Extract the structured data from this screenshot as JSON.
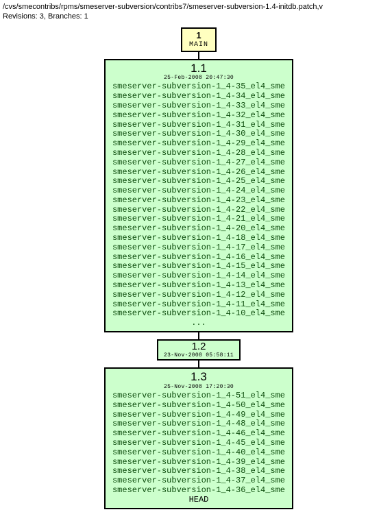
{
  "path": "/cvs/smecontribs/rpms/smeserver-subversion/contribs7/smeserver-subversion-1.4-initdb.patch,v",
  "info": "Revisions: 3, Branches: 1",
  "branch": {
    "number": "1",
    "name": "MAIN"
  },
  "rev11": {
    "title": "1.1",
    "date": "25-Feb-2008 20:47:30",
    "tags": [
      "smeserver-subversion-1_4-35_el4_sme",
      "smeserver-subversion-1_4-34_el4_sme",
      "smeserver-subversion-1_4-33_el4_sme",
      "smeserver-subversion-1_4-32_el4_sme",
      "smeserver-subversion-1_4-31_el4_sme",
      "smeserver-subversion-1_4-30_el4_sme",
      "smeserver-subversion-1_4-29_el4_sme",
      "smeserver-subversion-1_4-28_el4_sme",
      "smeserver-subversion-1_4-27_el4_sme",
      "smeserver-subversion-1_4-26_el4_sme",
      "smeserver-subversion-1_4-25_el4_sme",
      "smeserver-subversion-1_4-24_el4_sme",
      "smeserver-subversion-1_4-23_el4_sme",
      "smeserver-subversion-1_4-22_el4_sme",
      "smeserver-subversion-1_4-21_el4_sme",
      "smeserver-subversion-1_4-20_el4_sme",
      "smeserver-subversion-1_4-18_el4_sme",
      "smeserver-subversion-1_4-17_el4_sme",
      "smeserver-subversion-1_4-16_el4_sme",
      "smeserver-subversion-1_4-15_el4_sme",
      "smeserver-subversion-1_4-14_el4_sme",
      "smeserver-subversion-1_4-13_el4_sme",
      "smeserver-subversion-1_4-12_el4_sme",
      "smeserver-subversion-1_4-11_el4_sme",
      "smeserver-subversion-1_4-10_el4_sme"
    ],
    "ellipsis": "..."
  },
  "rev12": {
    "title": "1.2",
    "date": "23-Nov-2008 05:58:11"
  },
  "rev13": {
    "title": "1.3",
    "date": "25-Nov-2008 17:20:30",
    "tags": [
      "smeserver-subversion-1_4-51_el4_sme",
      "smeserver-subversion-1_4-50_el4_sme",
      "smeserver-subversion-1_4-49_el4_sme",
      "smeserver-subversion-1_4-48_el4_sme",
      "smeserver-subversion-1_4-46_el4_sme",
      "smeserver-subversion-1_4-45_el4_sme",
      "smeserver-subversion-1_4-40_el4_sme",
      "smeserver-subversion-1_4-39_el4_sme",
      "smeserver-subversion-1_4-38_el4_sme",
      "smeserver-subversion-1_4-37_el4_sme",
      "smeserver-subversion-1_4-36_el4_sme"
    ],
    "head": "HEAD"
  }
}
